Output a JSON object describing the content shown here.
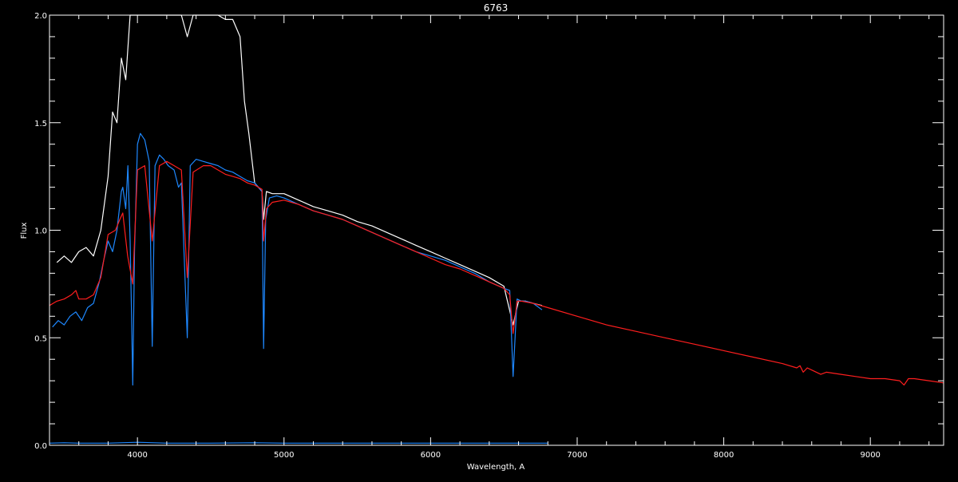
{
  "chart_data": {
    "type": "line",
    "title": "6763",
    "xlabel": "Wavelength, A",
    "ylabel": "Flux",
    "xlim": [
      3400,
      9500
    ],
    "ylim": [
      0.0,
      2.0
    ],
    "grid": false,
    "background": "#000000",
    "axis_color": "#ffffff",
    "x_ticks": [
      {
        "value": 4000,
        "label": "4000"
      },
      {
        "value": 5000,
        "label": "5000"
      },
      {
        "value": 6000,
        "label": "6000"
      },
      {
        "value": 7000,
        "label": "7000"
      },
      {
        "value": 8000,
        "label": "8000"
      },
      {
        "value": 9000,
        "label": "9000"
      }
    ],
    "y_ticks": [
      {
        "value": 0.0,
        "label": "0.0"
      },
      {
        "value": 0.5,
        "label": "0.5"
      },
      {
        "value": 1.0,
        "label": "1.0"
      },
      {
        "value": 1.5,
        "label": "1.5"
      },
      {
        "value": 2.0,
        "label": "2.0"
      }
    ],
    "series": [
      {
        "color": "#ffffff",
        "x": [
          3450,
          3500,
          3550,
          3600,
          3650,
          3700,
          3750,
          3800,
          3830,
          3860,
          3890,
          3920,
          3950,
          3970,
          4000,
          4050,
          4100,
          4150,
          4200,
          4250,
          4300,
          4340,
          4380,
          4450,
          4500,
          4550,
          4600,
          4650,
          4700,
          4730,
          4760,
          4800,
          4850,
          4861,
          4880,
          4920,
          5000,
          5100,
          5200,
          5300,
          5400,
          5500,
          5600,
          5700,
          5800,
          5900,
          6000,
          6100,
          6200,
          6300,
          6400,
          6500,
          6563,
          6600,
          6650,
          6700,
          6760
        ],
        "y": [
          0.85,
          0.88,
          0.85,
          0.9,
          0.92,
          0.88,
          1.0,
          1.25,
          1.55,
          1.5,
          1.8,
          1.7,
          2.0,
          2.0,
          2.0,
          2.0,
          2.0,
          2.0,
          2.0,
          2.0,
          2.0,
          1.9,
          2.0,
          2.0,
          2.0,
          2.0,
          1.98,
          1.98,
          1.9,
          1.6,
          1.45,
          1.22,
          1.18,
          1.05,
          1.18,
          1.17,
          1.17,
          1.14,
          1.11,
          1.09,
          1.07,
          1.04,
          1.02,
          0.99,
          0.96,
          0.93,
          0.9,
          0.87,
          0.84,
          0.81,
          0.78,
          0.74,
          0.56,
          0.67,
          0.67,
          0.66,
          0.65
        ]
      },
      {
        "color": "#1e88ff",
        "x": [
          3420,
          3460,
          3500,
          3540,
          3580,
          3620,
          3660,
          3700,
          3740,
          3770,
          3800,
          3830,
          3860,
          3890,
          3900,
          3920,
          3935,
          3950,
          3960,
          3968,
          3980,
          4000,
          4020,
          4050,
          4080,
          4101,
          4120,
          4150,
          4180,
          4210,
          4250,
          4280,
          4300,
          4340,
          4360,
          4400,
          4450,
          4500,
          4550,
          4600,
          4650,
          4700,
          4750,
          4800,
          4850,
          4861,
          4875,
          4900,
          4950,
          5000,
          5100,
          5200,
          5300,
          5400,
          5500,
          5600,
          5700,
          5800,
          5900,
          6000,
          6100,
          6200,
          6300,
          6400,
          6500,
          6540,
          6563,
          6590,
          6620,
          6650,
          6700,
          6760
        ],
        "y": [
          0.55,
          0.58,
          0.56,
          0.6,
          0.62,
          0.58,
          0.64,
          0.66,
          0.76,
          0.86,
          0.95,
          0.9,
          1.0,
          1.18,
          1.2,
          1.1,
          1.3,
          0.95,
          0.6,
          0.28,
          0.9,
          1.4,
          1.45,
          1.42,
          1.32,
          0.46,
          1.3,
          1.35,
          1.33,
          1.3,
          1.28,
          1.2,
          1.22,
          0.5,
          1.3,
          1.33,
          1.32,
          1.31,
          1.3,
          1.28,
          1.27,
          1.25,
          1.23,
          1.22,
          1.18,
          0.45,
          1.05,
          1.15,
          1.16,
          1.15,
          1.12,
          1.09,
          1.07,
          1.05,
          1.02,
          0.99,
          0.96,
          0.93,
          0.9,
          0.88,
          0.86,
          0.83,
          0.8,
          0.76,
          0.73,
          0.72,
          0.32,
          0.68,
          0.67,
          0.67,
          0.66,
          0.63
        ]
      },
      {
        "color": "#ff1e1e",
        "x": [
          3400,
          3450,
          3500,
          3550,
          3580,
          3600,
          3650,
          3700,
          3750,
          3800,
          3850,
          3880,
          3900,
          3933,
          3968,
          4000,
          4050,
          4101,
          4150,
          4200,
          4250,
          4300,
          4340,
          4380,
          4450,
          4500,
          4550,
          4600,
          4650,
          4700,
          4750,
          4800,
          4850,
          4861,
          4880,
          4920,
          5000,
          5100,
          5200,
          5300,
          5400,
          5500,
          5600,
          5700,
          5800,
          5900,
          6000,
          6100,
          6200,
          6300,
          6400,
          6500,
          6540,
          6563,
          6590,
          6620,
          6700,
          6800,
          7000,
          7200,
          7400,
          7600,
          7800,
          8000,
          8200,
          8400,
          8498,
          8520,
          8542,
          8570,
          8600,
          8662,
          8700,
          8800,
          8900,
          9000,
          9100,
          9200,
          9230,
          9260,
          9300,
          9400,
          9500
        ],
        "y": [
          0.65,
          0.67,
          0.68,
          0.7,
          0.72,
          0.68,
          0.68,
          0.7,
          0.78,
          0.98,
          1.0,
          1.05,
          1.08,
          0.88,
          0.75,
          1.28,
          1.3,
          0.95,
          1.3,
          1.32,
          1.3,
          1.28,
          0.78,
          1.27,
          1.3,
          1.3,
          1.28,
          1.26,
          1.25,
          1.24,
          1.22,
          1.21,
          1.19,
          0.95,
          1.1,
          1.13,
          1.14,
          1.12,
          1.09,
          1.07,
          1.05,
          1.02,
          0.99,
          0.96,
          0.93,
          0.9,
          0.87,
          0.84,
          0.82,
          0.79,
          0.76,
          0.73,
          0.7,
          0.52,
          0.67,
          0.67,
          0.66,
          0.64,
          0.6,
          0.56,
          0.53,
          0.5,
          0.47,
          0.44,
          0.41,
          0.38,
          0.36,
          0.37,
          0.34,
          0.36,
          0.35,
          0.33,
          0.34,
          0.33,
          0.32,
          0.31,
          0.31,
          0.3,
          0.28,
          0.31,
          0.31,
          0.3,
          0.29
        ]
      },
      {
        "color": "#1e88ff",
        "x": [
          3400,
          3500,
          3600,
          3800,
          4000,
          4200,
          4500,
          4800,
          5000,
          5500,
          6000,
          6500,
          6800
        ],
        "y": [
          0.01,
          0.012,
          0.01,
          0.01,
          0.014,
          0.01,
          0.01,
          0.012,
          0.01,
          0.01,
          0.01,
          0.01,
          0.01
        ]
      }
    ]
  }
}
